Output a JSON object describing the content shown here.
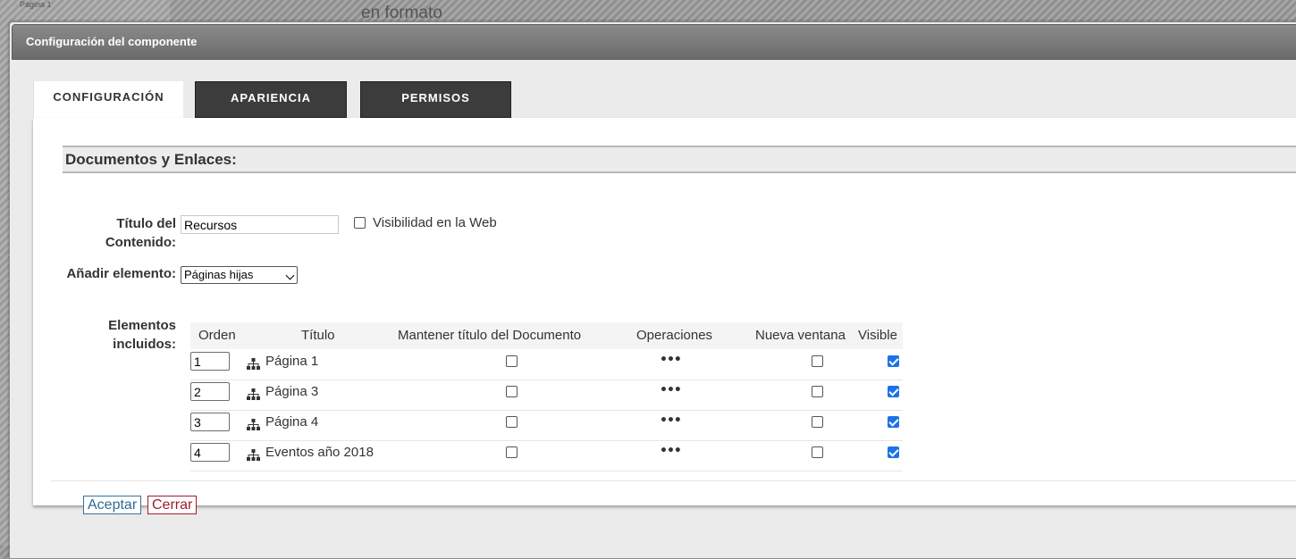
{
  "background": {
    "sidebar_hint": "Página 1",
    "text": "en formato"
  },
  "dialog": {
    "title": "Configuración del componente"
  },
  "tabs": [
    {
      "label": "CONFIGURACIÓN",
      "active": true
    },
    {
      "label": "APARIENCIA",
      "active": false
    },
    {
      "label": "PERMISOS",
      "active": false
    }
  ],
  "section": {
    "header": "Documentos y Enlaces:"
  },
  "form": {
    "title_label_line1": "Título del",
    "title_label_line2": "Contenido:",
    "title_value": "Recursos",
    "visibility_label": "Visibilidad en la Web",
    "visibility_checked": false,
    "add_label": "Añadir elemento:",
    "add_selected": "Páginas hijas",
    "included_label_line1": "Elementos",
    "included_label_line2": "incluidos:"
  },
  "table": {
    "headers": {
      "order": "Orden",
      "title": "Título",
      "keep_title": "Mantener título del Documento",
      "operations": "Operaciones",
      "new_window": "Nueva ventana",
      "visible": "Visible"
    },
    "rows": [
      {
        "order": "1",
        "title": "Página 1",
        "keep_title": false,
        "operations": "•••",
        "new_window": false,
        "visible": true
      },
      {
        "order": "2",
        "title": "Página 3",
        "keep_title": false,
        "operations": "•••",
        "new_window": false,
        "visible": true
      },
      {
        "order": "3",
        "title": "Página 4",
        "keep_title": false,
        "operations": "•••",
        "new_window": false,
        "visible": true
      },
      {
        "order": "4",
        "title": "Eventos año 2018",
        "keep_title": false,
        "operations": "•••",
        "new_window": false,
        "visible": true
      }
    ]
  },
  "buttons": {
    "accept": "Aceptar",
    "close": "Cerrar"
  },
  "icons": {
    "row_icon": "sitemap-icon",
    "operations_icon": "ellipsis-icon"
  },
  "colors": {
    "accept": "#2e6b97",
    "close": "#9e1c2a",
    "checkbox_checked": "#1a73e8",
    "titlebar": "#7b7b7b",
    "tab_dark": "#3c3c3c"
  }
}
